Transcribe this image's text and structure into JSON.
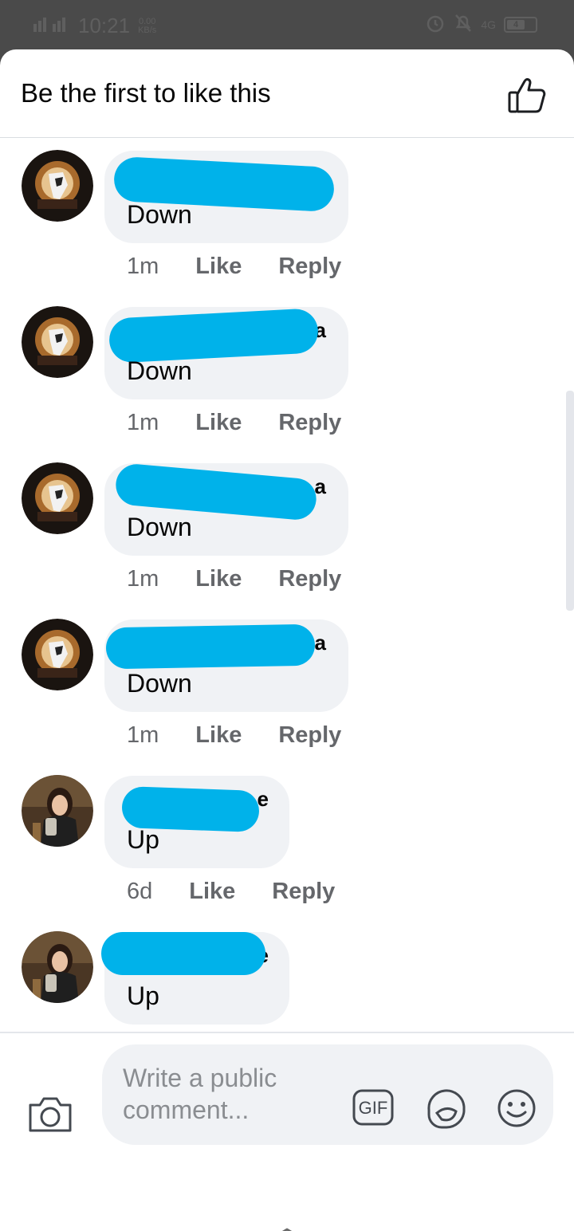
{
  "status_bar": {
    "time": "10:21",
    "speed_value": "0.00",
    "speed_unit": "KB/s",
    "network": "4G",
    "battery_level": "4"
  },
  "header": {
    "title": "Be the first to like this",
    "like_icon": "thumbs-up-icon"
  },
  "comments": [
    {
      "author": "",
      "text": "Down",
      "time": "1m",
      "like_label": "Like",
      "reply_label": "Reply",
      "avatar": "eagle-avatar"
    },
    {
      "author": "a",
      "text": "Down",
      "time": "1m",
      "like_label": "Like",
      "reply_label": "Reply",
      "avatar": "eagle-avatar"
    },
    {
      "author": "a",
      "text": "Down",
      "time": "1m",
      "like_label": "Like",
      "reply_label": "Reply",
      "avatar": "eagle-avatar"
    },
    {
      "author": "a",
      "text": "Down",
      "time": "1m",
      "like_label": "Like",
      "reply_label": "Reply",
      "avatar": "eagle-avatar"
    },
    {
      "author": "e",
      "text": "Up",
      "time": "6d",
      "like_label": "Like",
      "reply_label": "Reply",
      "avatar": "woman-avatar"
    },
    {
      "author": "e",
      "text": "Up",
      "time": "",
      "like_label": "",
      "reply_label": "",
      "avatar": "woman-avatar"
    }
  ],
  "composer": {
    "placeholder": "Write a public comment...",
    "camera_icon": "camera-icon",
    "gif_label": "GIF",
    "sticker_icon": "sticker-icon",
    "emoji_icon": "emoji-icon"
  },
  "navbar": {
    "menu_icon": "menu-icon",
    "home_icon": "home-icon",
    "back_icon": "back-icon"
  },
  "colors": {
    "redaction": "#00b2ea",
    "bubble": "#f0f2f5",
    "meta_text": "#65676b",
    "status_bar_bg": "#4a4a4a"
  }
}
